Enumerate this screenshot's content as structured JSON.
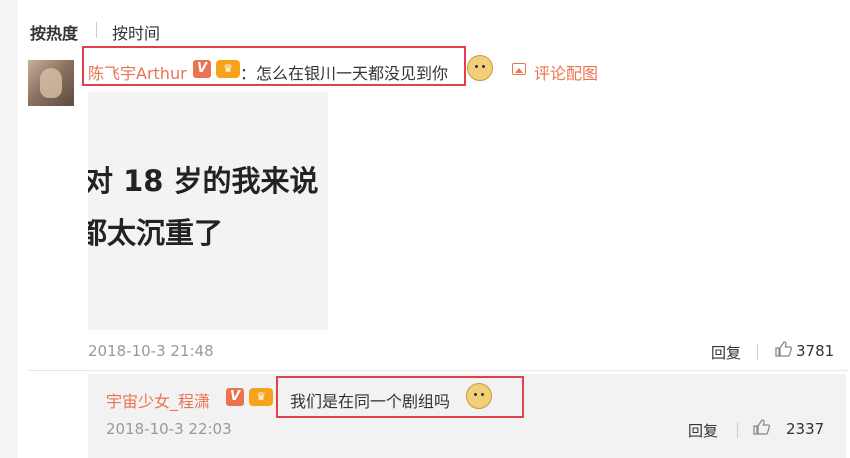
{
  "sort": {
    "hot_label": "按热度",
    "time_label": "按时间"
  },
  "comment1": {
    "username": "陈飞宇Arthur",
    "verified_badge": "V",
    "fan_badge": "fan-crown-icon",
    "text": "：怎么在银川一天都没见到你",
    "emoji": "doge-emoji-icon",
    "pic_link": "评论配图",
    "image_lines": [
      "对 18 岁的我来说",
      "都太沉重了"
    ],
    "time": "2018-10-3 21:48",
    "reply_label": "回复",
    "like_count": "3781"
  },
  "comment2": {
    "username": "宇宙少女_程潇",
    "verified_badge": "V",
    "fan_badge": "fan-crown-icon",
    "text": "我们是在同一个剧组吗",
    "emoji": "cat-emoji-icon",
    "time": "2018-10-3 22:03",
    "reply_label": "回复",
    "like_count": "2337"
  },
  "colors": {
    "accent": "#eb7350",
    "highlight_box": "#e0414a",
    "muted": "#999999"
  }
}
